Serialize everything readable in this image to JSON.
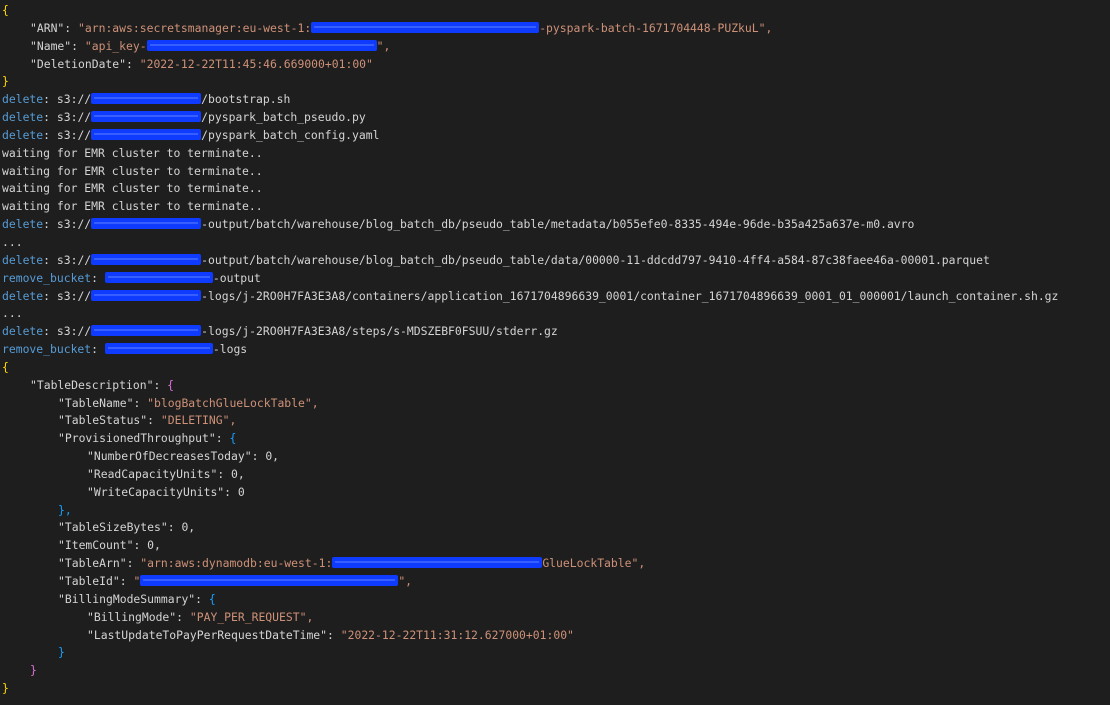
{
  "colors": {
    "background": "#1e1e1e",
    "text": "#d4d4d4",
    "string": "#ce9178",
    "keyword": "#569cd6",
    "brace_level1": "#ffd700",
    "brace_level2": "#da70d6",
    "brace_level3": "#179fff",
    "redaction": "#0f3bff"
  },
  "secret": {
    "open_brace": "{",
    "arn_key": "\"ARN\"",
    "arn_prefix": "\"arn:aws:secretsmanager:eu-west-1:",
    "arn_suffix": "-pyspark-batch-1671704448-PUZkuL\",",
    "name_key": "\"Name\"",
    "name_prefix": "\"api_key-",
    "name_suffix": "\",",
    "deletion_key": "\"DeletionDate\"",
    "deletion_value": "\"2022-12-22T11:45:46.669000+01:00\"",
    "close_brace": "}"
  },
  "log": {
    "delete_kw": "delete",
    "remove_bucket_kw": "remove_bucket",
    "s3_prefix": "s3://",
    "file1": "/bootstrap.sh",
    "file2": "/pyspark_batch_pseudo.py",
    "file3": "/pyspark_batch_config.yaml",
    "waiting": "waiting for EMR cluster to terminate..",
    "metadata_path": "-output/batch/warehouse/blog_batch_db/pseudo_table/metadata/b055efe0-8335-494e-96de-b35a425a637e-m0.avro",
    "ellipsis": "...",
    "data_path": "-output/batch/warehouse/blog_batch_db/pseudo_table/data/00000-11-ddcdd797-9410-4ff4-a584-87c38faee46a-00001.parquet",
    "output_suffix": "-output",
    "container_path": "-logs/j-2RO0H7FA3E3A8/containers/application_1671704896639_0001/container_1671704896639_0001_01_000001/launch_container.sh.gz",
    "stderr_path": "-logs/j-2RO0H7FA3E3A8/steps/s-MDSZEBF0FSUU/stderr.gz",
    "logs_suffix": "-logs"
  },
  "table": {
    "open_brace": "{",
    "description_key": "\"TableDescription\"",
    "desc_open": "{",
    "name_key": "\"TableName\"",
    "name_value": "\"blogBatchGlueLockTable\",",
    "status_key": "\"TableStatus\"",
    "status_value": "\"DELETING\",",
    "throughput_key": "\"ProvisionedThroughput\"",
    "throughput_open": "{",
    "decreases_key": "\"NumberOfDecreasesToday\"",
    "decreases_value": "0,",
    "read_key": "\"ReadCapacityUnits\"",
    "read_value": "0,",
    "write_key": "\"WriteCapacityUnits\"",
    "write_value": "0",
    "throughput_close": "},",
    "size_key": "\"TableSizeBytes\"",
    "size_value": "0,",
    "count_key": "\"ItemCount\"",
    "count_value": "0,",
    "arn_key": "\"TableArn\"",
    "arn_prefix": "\"arn:aws:dynamodb:eu-west-1:",
    "arn_suffix": "GlueLockTable\",",
    "id_key": "\"TableId\"",
    "id_prefix": "\"",
    "id_suffix": "\",",
    "billing_key": "\"BillingModeSummary\"",
    "billing_open": "{",
    "mode_key": "\"BillingMode\"",
    "mode_value": "\"PAY_PER_REQUEST\",",
    "lastupdate_key": "\"LastUpdateToPayPerRequestDateTime\"",
    "lastupdate_value": "\"2022-12-22T11:31:12.627000+01:00\"",
    "billing_close": "}",
    "desc_close": "}",
    "close_brace": "}"
  }
}
